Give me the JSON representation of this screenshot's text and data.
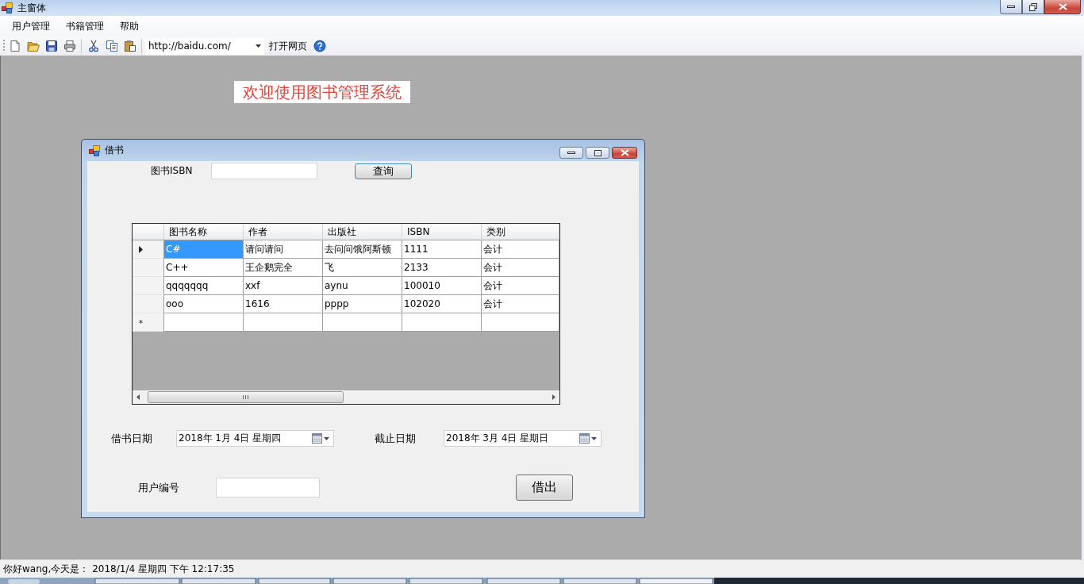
{
  "main_window": {
    "title": "主窗体"
  },
  "menu_bar": [
    "用户管理",
    "书籍管理",
    "帮助"
  ],
  "toolbar": {
    "url_combo": {
      "value": "http://baidu.com/"
    },
    "open_page_button": "打开网页"
  },
  "welcome_label": "欢迎使用图书管理系统",
  "borrow_window": {
    "title": "借书",
    "isbn_label": "图书ISBN",
    "search_button": "查询",
    "grid": {
      "columns": [
        "图书名称",
        "作者",
        "出版社",
        "ISBN",
        "类别"
      ],
      "rows": [
        {
          "current": true,
          "cells": [
            {
              "text": "C#",
              "selected": true
            },
            {
              "text": "请问请问",
              "selected": false
            },
            {
              "text": "去问问饿阿斯顿",
              "selected": false
            },
            {
              "text": "1111",
              "selected": false
            },
            {
              "text": "会计",
              "selected": false
            }
          ]
        },
        {
          "current": false,
          "cells": [
            {
              "text": "C++",
              "selected": false
            },
            {
              "text": "王企鹅完全",
              "selected": false
            },
            {
              "text": "飞",
              "selected": false
            },
            {
              "text": "2133",
              "selected": false
            },
            {
              "text": "会计",
              "selected": false
            }
          ]
        },
        {
          "current": false,
          "cells": [
            {
              "text": "qqqqqqq",
              "selected": false
            },
            {
              "text": "xxf",
              "selected": false
            },
            {
              "text": "aynu",
              "selected": false
            },
            {
              "text": "100010",
              "selected": false
            },
            {
              "text": "会计",
              "selected": false
            }
          ]
        },
        {
          "current": false,
          "cells": [
            {
              "text": "ooo",
              "selected": false
            },
            {
              "text": "1616",
              "selected": false
            },
            {
              "text": "pppp",
              "selected": false
            },
            {
              "text": "102020",
              "selected": false
            },
            {
              "text": "会计",
              "selected": false
            }
          ]
        }
      ],
      "new_row_marker": "*"
    },
    "borrow_date": {
      "label": "借书日期",
      "value": "2018年 1月 4日 星期四"
    },
    "due_date": {
      "label": "截止日期",
      "value": "2018年 3月 4日 星期日"
    },
    "user_id": {
      "label": "用户编号"
    },
    "borrow_button": "借出"
  },
  "status_bar": [
    "你好wang,今天是：",
    "2018/1/4 星期四 下午 12:17:35"
  ]
}
